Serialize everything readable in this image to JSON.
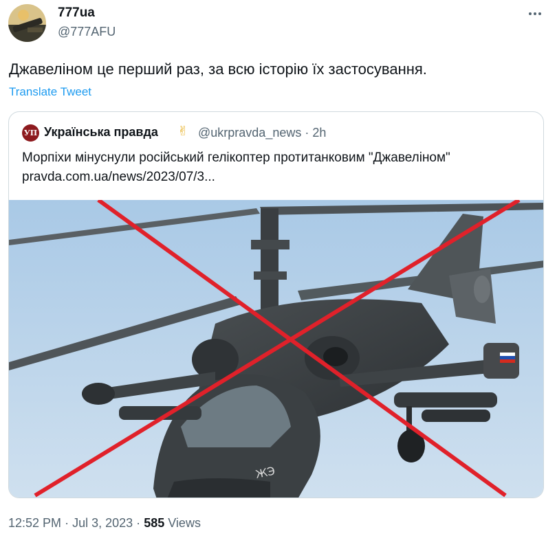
{
  "author": {
    "name": "777ua",
    "handle": "@777AFU"
  },
  "tweet": {
    "text": "Джавеліном це перший раз, за всю історію їх застосування.",
    "translate_label": "Translate Tweet"
  },
  "quoted": {
    "avatar_text": "УП",
    "name": "Українська правда",
    "emoji": "✌",
    "handle": "@ukrpravda_news",
    "separator": "·",
    "time": "2h",
    "text_line1": "Морпіхи мінуснули російський гелікоптер протитанковим \"Джавеліном\"",
    "text_line2": "pravda.com.ua/news/2023/07/3...",
    "image_marking": "ЖЭ"
  },
  "meta": {
    "time": "12:52 PM",
    "separator": "·",
    "date": "Jul 3, 2023",
    "views_count": "585",
    "views_label": "Views"
  },
  "icons": {
    "more": "more-icon",
    "avatar": "avatar"
  },
  "colors": {
    "link": "#1d9bf0",
    "secondary_text": "#536471",
    "cross": "#e0212a",
    "sky": "#b9d3ea"
  }
}
